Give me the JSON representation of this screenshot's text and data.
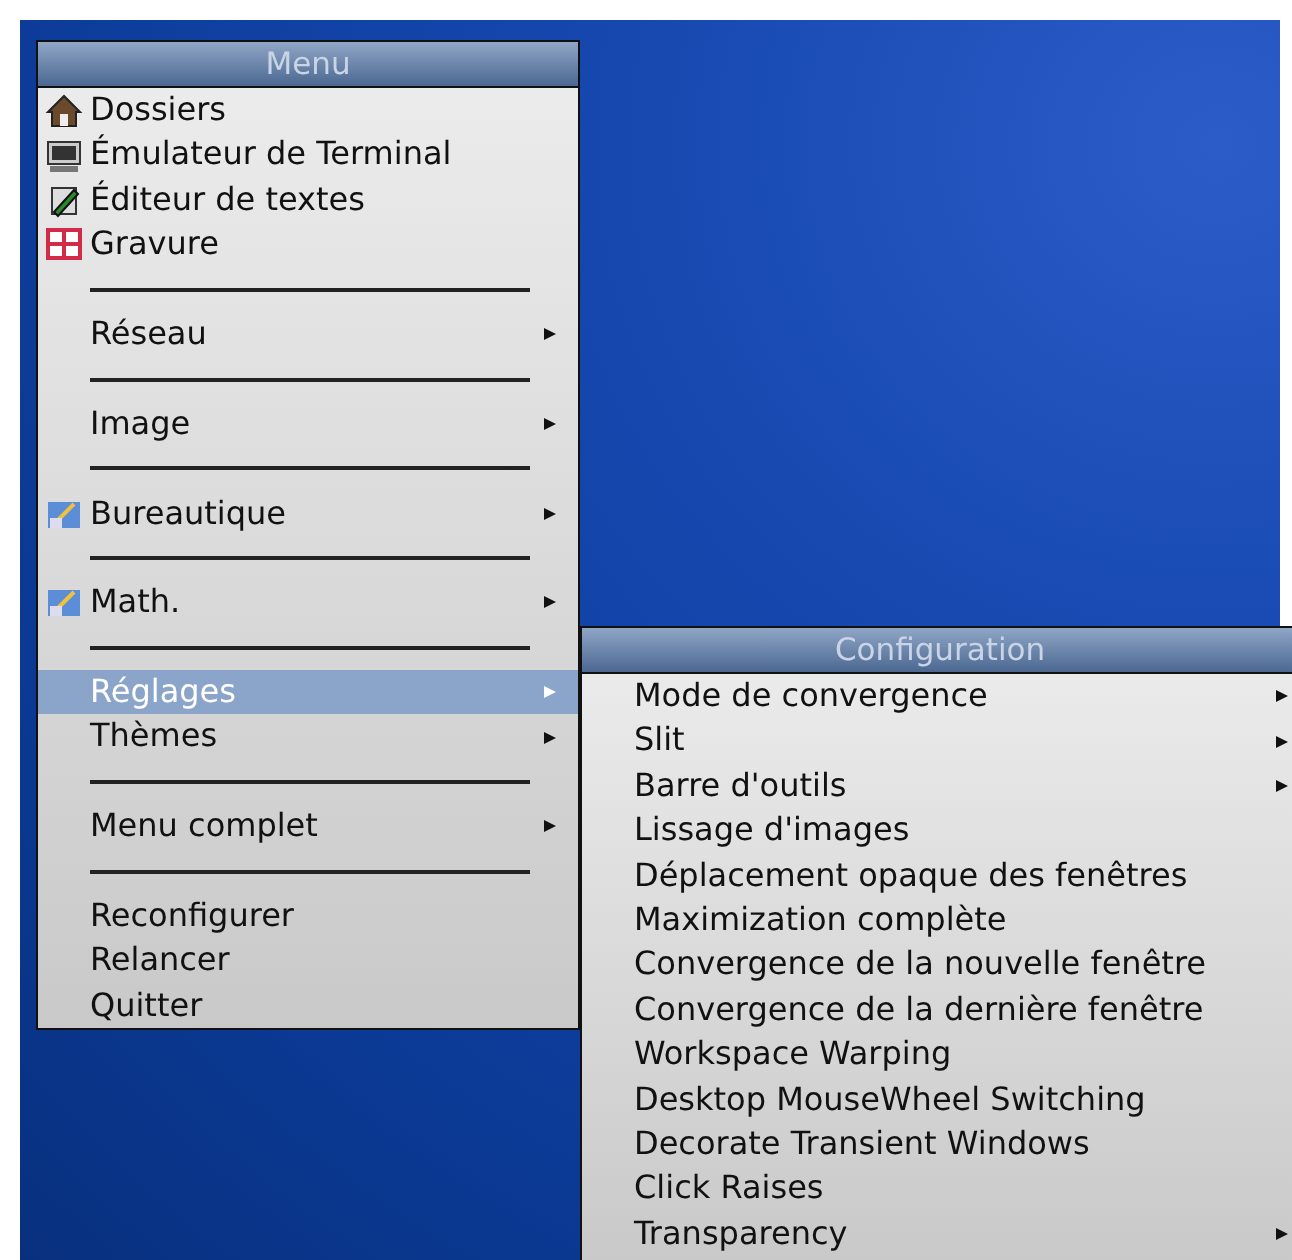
{
  "menu": {
    "title": "Menu",
    "items": [
      {
        "kind": "launcher",
        "label": "Dossiers",
        "icon": true,
        "selected": false
      },
      {
        "kind": "launcher",
        "label": "Émulateur de Terminal",
        "icon": true,
        "selected": false
      },
      {
        "kind": "launcher",
        "label": "Éditeur de textes",
        "icon": true,
        "selected": false
      },
      {
        "kind": "launcher",
        "label": "Gravure",
        "icon": true,
        "selected": false
      },
      {
        "kind": "separator"
      },
      {
        "kind": "submenu",
        "label": "Réseau",
        "icon": false,
        "selected": false
      },
      {
        "kind": "separator"
      },
      {
        "kind": "submenu",
        "label": "Image",
        "icon": false,
        "selected": false
      },
      {
        "kind": "separator"
      },
      {
        "kind": "submenu",
        "label": "Bureautique",
        "icon": true,
        "selected": false
      },
      {
        "kind": "separator"
      },
      {
        "kind": "submenu",
        "label": "Math.",
        "icon": true,
        "selected": false
      },
      {
        "kind": "separator"
      },
      {
        "kind": "submenu",
        "label": "Réglages",
        "icon": false,
        "selected": true
      },
      {
        "kind": "submenu",
        "label": "Thèmes",
        "icon": false,
        "selected": false
      },
      {
        "kind": "separator"
      },
      {
        "kind": "submenu",
        "label": "Menu complet",
        "icon": false,
        "selected": false
      },
      {
        "kind": "separator"
      },
      {
        "kind": "command",
        "label": "Reconfigurer",
        "icon": false,
        "selected": false
      },
      {
        "kind": "command",
        "label": "Relancer",
        "icon": false,
        "selected": false
      },
      {
        "kind": "command",
        "label": "Quitter",
        "icon": false,
        "selected": false
      }
    ]
  },
  "submenu": {
    "title": "Configuration",
    "items": [
      {
        "kind": "submenu",
        "label": "Mode de convergence",
        "selected": false
      },
      {
        "kind": "submenu",
        "label": "Slit",
        "selected": false
      },
      {
        "kind": "submenu",
        "label": "Barre d'outils",
        "selected": false
      },
      {
        "kind": "command",
        "label": "Lissage d'images",
        "selected": false
      },
      {
        "kind": "command",
        "label": "Déplacement opaque des fenêtres",
        "selected": false
      },
      {
        "kind": "command",
        "label": "Maximization complète",
        "selected": false
      },
      {
        "kind": "command",
        "label": "Convergence de la nouvelle fenêtre",
        "selected": false
      },
      {
        "kind": "command",
        "label": "Convergence de la dernière fenêtre",
        "selected": false
      },
      {
        "kind": "command",
        "label": "Workspace Warping",
        "selected": false
      },
      {
        "kind": "command",
        "label": "Desktop MouseWheel Switching",
        "selected": false
      },
      {
        "kind": "command",
        "label": "Decorate Transient Windows",
        "selected": false
      },
      {
        "kind": "command",
        "label": "Click Raises",
        "selected": false
      },
      {
        "kind": "submenu",
        "label": "Transparency",
        "selected": false
      }
    ]
  }
}
